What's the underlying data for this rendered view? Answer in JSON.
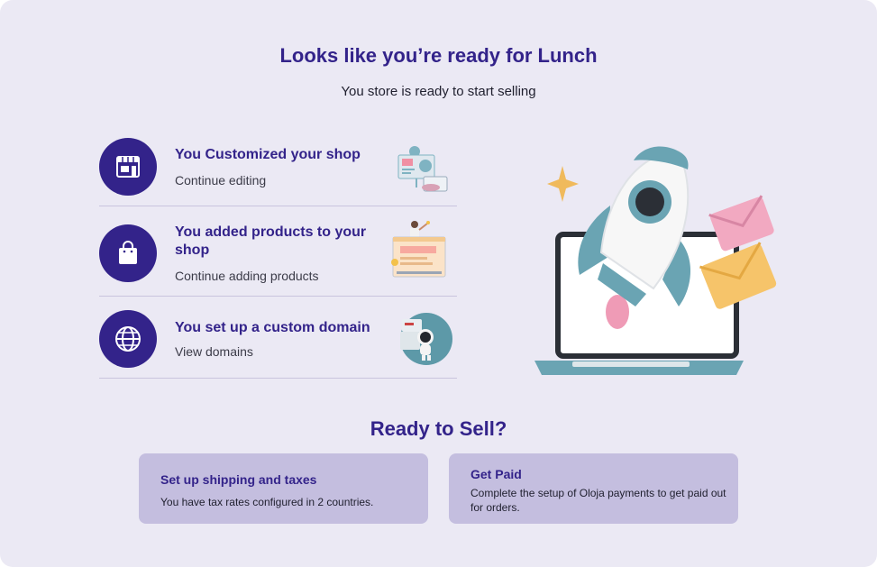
{
  "header": {
    "title": "Looks like you’re ready for Lunch",
    "subtitle": "You store is ready to start selling"
  },
  "steps": [
    {
      "icon": "storefront-icon",
      "title": "You Customized your shop",
      "link": "Continue editing",
      "illustration": "design-dashboard-illustration"
    },
    {
      "icon": "shopping-bag-icon",
      "title": "You added products to your shop",
      "link": "Continue adding products",
      "illustration": "product-listing-illustration"
    },
    {
      "icon": "globe-icon",
      "title": "You set up a custom domain",
      "link": "View domains",
      "illustration": "astronaut-domain-illustration"
    }
  ],
  "hero": {
    "illustration": "rocket-laptop-illustration"
  },
  "ready_section": {
    "title": "Ready to Sell?",
    "cards": [
      {
        "title": "Set up shipping and taxes",
        "description": "You have tax rates configured in 2 countries."
      },
      {
        "title": "Get Paid",
        "description": "Complete the setup of Oloja payments to get paid out for orders."
      }
    ]
  },
  "colors": {
    "background": "#ebe9f4",
    "accent": "#33238a",
    "card": "#c4bedf",
    "divider": "#c9c4de"
  }
}
